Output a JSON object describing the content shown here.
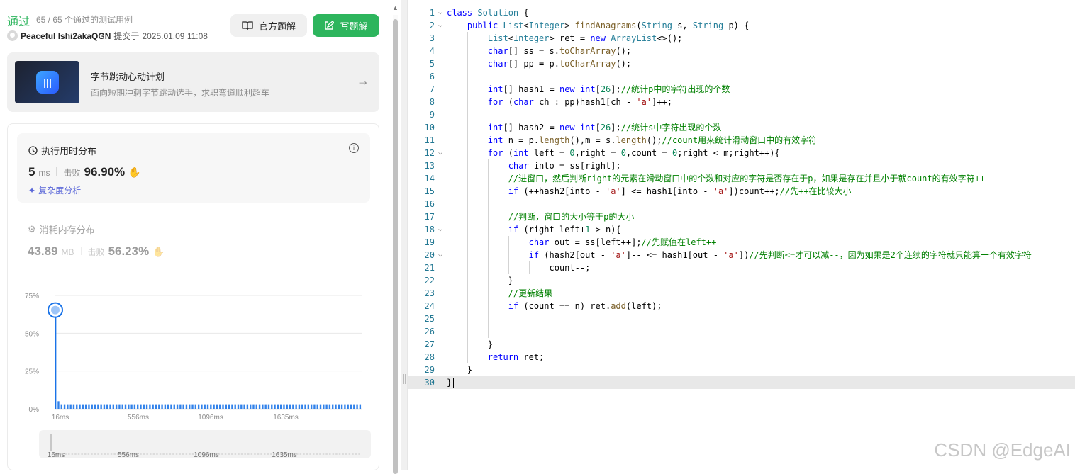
{
  "submission": {
    "status": "通过",
    "cases": "65 / 65 个通过的测试用例",
    "username": "Peaceful Ishi2akaQGN",
    "submitted_prefix": "提交于",
    "submitted_at": "2025.01.09 11:08",
    "official_solution_label": "官方题解",
    "write_solution_label": "写题解"
  },
  "promo": {
    "title": "字节跳动心动计划",
    "subtitle": "面向短期冲刺字节跳动选手，求职弯道顺利超车"
  },
  "runtime": {
    "title": "执行用时分布",
    "value": "5",
    "unit": "ms",
    "beat_label": "击败",
    "beat_percent": "96.90%",
    "complexity_label": "复杂度分析"
  },
  "memory": {
    "title": "消耗内存分布",
    "value": "43.89",
    "unit": "MB",
    "beat_label": "击败",
    "beat_percent": "56.23%"
  },
  "chart_data": {
    "type": "bar",
    "title": "",
    "xlabel": "",
    "ylabel": "",
    "y_ticks": [
      "75%",
      "50%",
      "25%",
      "0%"
    ],
    "ylim": [
      0,
      75
    ],
    "x_ticks": [
      "16ms",
      "556ms",
      "1096ms",
      "1635ms"
    ],
    "grid": true,
    "highlighted_bar_index": 0,
    "values": [
      70,
      5,
      3,
      3,
      3,
      3,
      3,
      3,
      3,
      3,
      3,
      3,
      3,
      3,
      3,
      3,
      3,
      3,
      3,
      3,
      3,
      3,
      3,
      3,
      3,
      3,
      3,
      3,
      3,
      3,
      3,
      3,
      3,
      3,
      3,
      3,
      3,
      3,
      3,
      3,
      3,
      3,
      3,
      3,
      3,
      3,
      3,
      3,
      3,
      3,
      3,
      3,
      3,
      3,
      3,
      3,
      3,
      3,
      3,
      3,
      3,
      3,
      3,
      3,
      3,
      3,
      3,
      3,
      3,
      3,
      3,
      3,
      3,
      3,
      3,
      3,
      3,
      3,
      3,
      3,
      3,
      3,
      3,
      3,
      3,
      3,
      3,
      3,
      3,
      3,
      3,
      3,
      3,
      3,
      3,
      3,
      3,
      3,
      3,
      3,
      3
    ]
  },
  "mini_axis": [
    "16ms",
    "556ms",
    "1096ms",
    "1635ms"
  ],
  "watermark": "CSDN @EdgeAI",
  "code_lines": [
    "class Solution {",
    "    public List<Integer> findAnagrams(String s, String p) {",
    "        List<Integer> ret = new ArrayList<>();",
    "        char[] ss = s.toCharArray();",
    "        char[] pp = p.toCharArray();",
    "",
    "        int[] hash1 = new int[26];//统计p中的字符出现的个数",
    "        for (char ch : pp)hash1[ch - 'a']++;",
    "",
    "        int[] hash2 = new int[26];//统计s中字符出现的个数",
    "        int n = p.length(),m = s.length();//count用来统计滑动窗口中的有效字符",
    "        for (int left = 0,right = 0,count = 0;right < m;right++){",
    "            char into = ss[right];",
    "            //进窗口，然后判断right的元素在滑动窗口中的个数和对应的字符是否存在于p，如果是存在并且小于就count的有效字符++",
    "            if (++hash2[into - 'a'] <= hash1[into - 'a'])count++;//先++在比较大小",
    "",
    "            //判断，窗口的大小等于p的大小",
    "            if (right-left+1 > n){",
    "                char out = ss[left++];//先赋值在left++",
    "                if (hash2[out - 'a']-- <= hash1[out - 'a'])//先判断<=才可以减--，因为如果是2个连续的字符就只能算一个有效字符",
    "                    count--;",
    "            }",
    "            //更新结果",
    "            if (count == n) ret.add(left);",
    "",
    "",
    "        }",
    "        return ret;",
    "    }",
    "}"
  ],
  "colors": {
    "accent_green": "#2db55d",
    "bar_blue": "#1a73e8",
    "line_number": "#237893"
  }
}
